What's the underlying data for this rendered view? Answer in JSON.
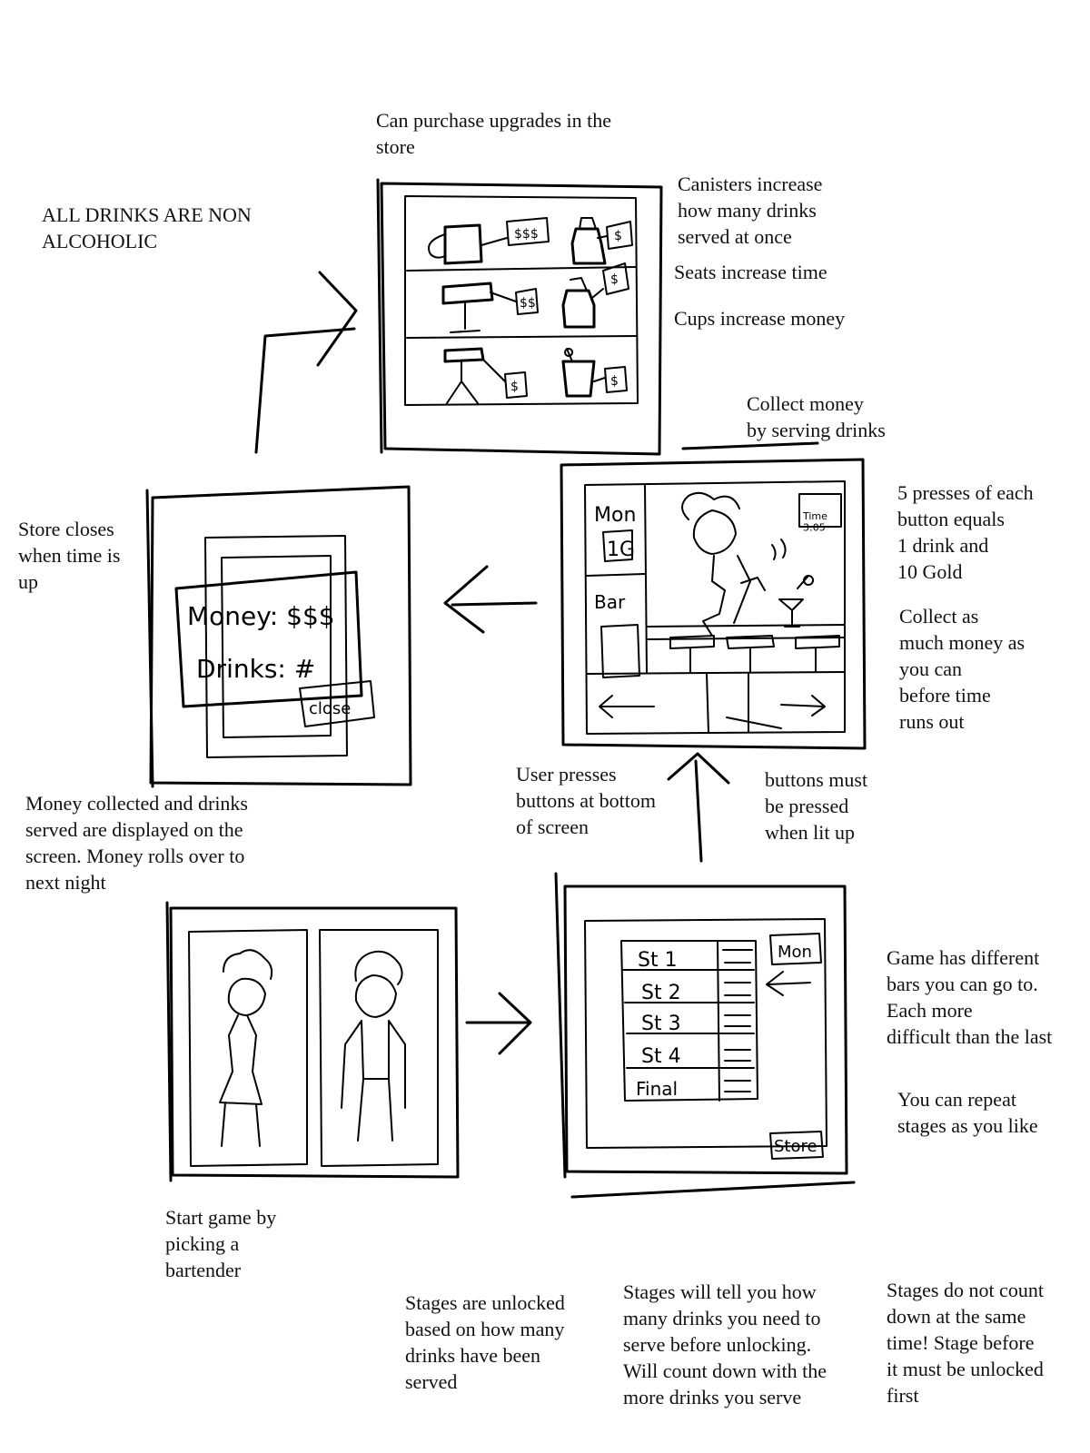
{
  "notes": {
    "store_purchase": "Can purchase upgrades in the\nstore",
    "all_drinks": "ALL DRINKS ARE NON\nALCOHOLIC",
    "canisters": "Canisters increase\nhow many drinks\nserved at once",
    "seats": "Seats increase time",
    "cups": "Cups increase money",
    "collect_money": "Collect money\nby serving drinks",
    "presses": "5 presses of each\nbutton equals\n1 drink and\n10 Gold",
    "collect_much": "Collect as\nmuch money as\nyou can\nbefore time\nruns out",
    "store_closes": "Store closes\nwhen time is\nup",
    "user_presses": "User presses\nbuttons at bottom\nof screen",
    "buttons_lit": "buttons must\nbe pressed\nwhen lit up",
    "money_collected": "Money collected and drinks\nserved are displayed on the\nscreen. Money rolls over to\nnext night",
    "different_bars": "Game has different\nbars you can go to.\nEach more\ndifficult than the last",
    "repeat_stages": "You can repeat\nstages as you like",
    "start_game": "Start game by\npicking a\nbartender",
    "unlocked": "Stages are unlocked\nbased on how many\ndrinks have been\nserved",
    "tell_you": "Stages will tell you how\nmany drinks you need to\nserve before unlocking.\nWill count down with the\nmore drinks you serve",
    "not_count": "Stages do not count\ndown at the same\ntime! Stage before\nit must be unlocked\nfirst"
  },
  "sketch_labels": {
    "price_triple": "$$$",
    "price_double": "$$",
    "price_single": "$",
    "mon": "Mon",
    "money_value": "1G",
    "time": "Time\n3:05",
    "bar": "Bar",
    "results_money": "Money: $$$",
    "results_drinks": "Drinks: #",
    "close": "close",
    "mon_tab": "Mon",
    "stages": [
      "St 1",
      "St 2",
      "St 3",
      "St 4",
      "Final"
    ],
    "store": "Store"
  }
}
